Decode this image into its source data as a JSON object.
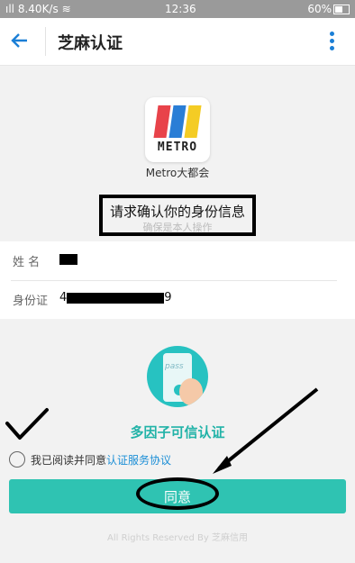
{
  "status_bar": {
    "signal_speed": "8.40K/s",
    "time": "12:36",
    "battery": "60%"
  },
  "app_bar": {
    "title": "芝麻认证"
  },
  "app": {
    "logo_text": "METRO",
    "name": "Metro大都会"
  },
  "request": {
    "main": "请求确认你的身份信息",
    "sub": "确保是本人操作"
  },
  "identity": {
    "name_label": "姓 名",
    "id_label": "身份证",
    "id_prefix": "4",
    "id_suffix": "9"
  },
  "auth": {
    "title": "多因子可信认证",
    "pass_label": "pass"
  },
  "agreement": {
    "text": "我已阅读并同意",
    "link": "认证服务协议"
  },
  "agree_button": {
    "label": "同意"
  },
  "footer": {
    "text": "All Rights Reserved By 芝麻信用"
  },
  "colors": {
    "accent": "#1b7fd6",
    "teal": "#2fc3b2",
    "metro_red": "#e8434a",
    "metro_blue": "#2a7ed6",
    "metro_yellow": "#f4cc24"
  }
}
